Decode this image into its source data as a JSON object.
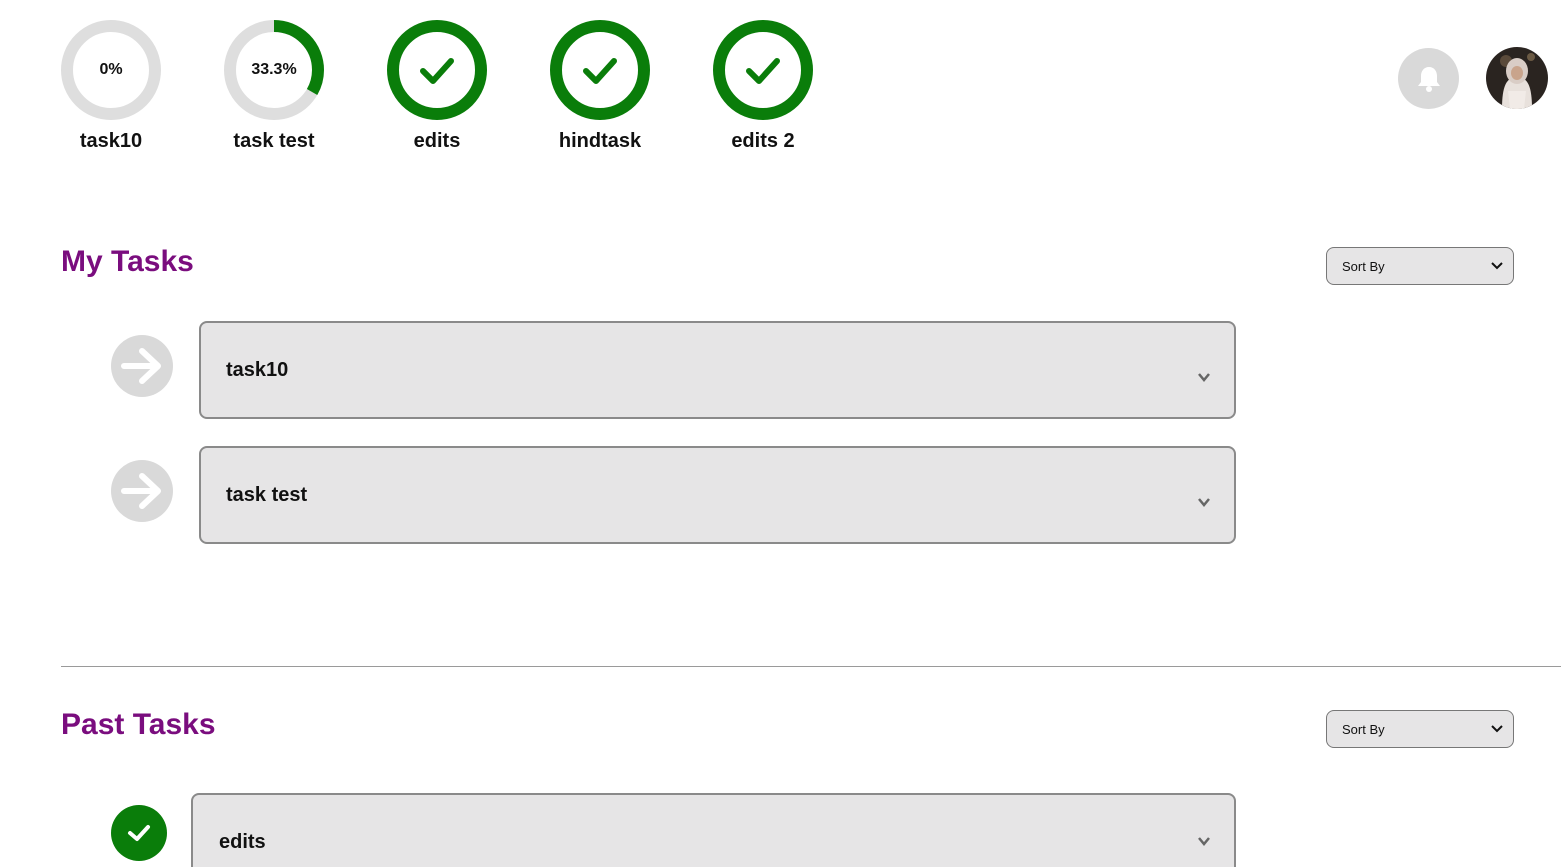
{
  "progress": [
    {
      "label": "task10",
      "percent_text": "0%",
      "fraction": 0.0,
      "complete": false
    },
    {
      "label": "task test",
      "percent_text": "33.3%",
      "fraction": 0.333,
      "complete": false
    },
    {
      "label": "edits",
      "percent_text": "",
      "fraction": 1.0,
      "complete": true
    },
    {
      "label": "hindtask",
      "percent_text": "",
      "fraction": 1.0,
      "complete": true
    },
    {
      "label": "edits 2",
      "percent_text": "",
      "fraction": 1.0,
      "complete": true
    }
  ],
  "header": {
    "bell_icon": "bell-icon",
    "avatar": "user-avatar"
  },
  "my_tasks": {
    "title": "My Tasks",
    "sort_label": "Sort By",
    "items": [
      {
        "name": "task10",
        "status_icon": "arrow-right-icon"
      },
      {
        "name": "task test",
        "status_icon": "arrow-right-icon"
      }
    ]
  },
  "past_tasks": {
    "title": "Past Tasks",
    "sort_label": "Sort By",
    "items": [
      {
        "name": "edits",
        "status_icon": "check-icon"
      }
    ]
  },
  "colors": {
    "accent": "#7a0d7e",
    "complete": "#0a7d0a",
    "ring_track": "#dedede",
    "card_bg": "#e6e5e6"
  }
}
